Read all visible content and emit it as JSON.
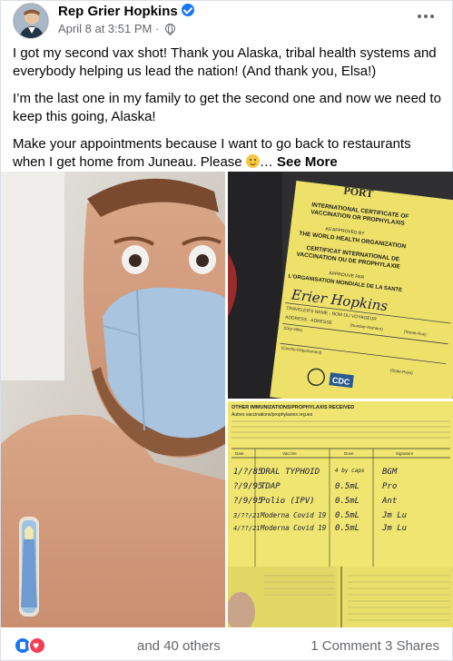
{
  "post": {
    "author": "Rep Grier Hopkins",
    "timestamp": "April 8 at 3:51 PM",
    "separator": "·",
    "privacy_icon": "globe-icon",
    "more_icon": "more-horizontal-icon",
    "paragraphs": [
      "I got my second vax shot! Thank you Alaska, tribal health systems and everybody helping us lead the nation! (And thank you, Elsa!)",
      "I’m the last one in my family to get the second one and now we need to keep this going, Alaska!"
    ],
    "truncated_paragraph": "Make your appointments because I want to go back to restaurants when I get home from Juneau. Please",
    "ellipsis": "…",
    "see_more": "See More"
  },
  "certificate": {
    "header_partial": "PORT",
    "title_en": "INTERNATIONAL CERTIFICATE OF VACCINATION OR PROPHYLAXIS",
    "approved_en": "AS APPROVED BY",
    "org_en": "THE WORLD HEALTH ORGANIZATION",
    "title_fr": "CERTIFICAT INTERNATIONAL DE VACCINATION OU DE PROPHYLAXIE",
    "approved_fr": "APPROUVE PAR",
    "org_fr": "L'ORGANISATION MONDIALE DE LA SANTE",
    "name_handwritten": "Erier Hopkins",
    "name_field": "TRAVELER'S NAME - NOM DU VOYAGEUR",
    "address_field": "ADDRESS - ADRESSE",
    "address_sub": [
      "(Number-Numéro)",
      "(Street-Rue)"
    ],
    "city_field": "(City-Ville)",
    "county_field": "(County-Département)",
    "state_field": "(State-Pays)",
    "logo_text": "CDC"
  },
  "record": {
    "heading": "OTHER IMMUNIZATIONS/PROPHYLAXIS RECEIVED",
    "heading_fr": "Autres vaccinations/prophylaxies reçues",
    "columns": [
      "Date",
      "Vaccine",
      "Dose",
      "Signature"
    ],
    "entries": [
      {
        "date": "1/?/85",
        "vaccine": "ORAL TYPHOID",
        "dose": "4 by caps",
        "sig": "BGM"
      },
      {
        "date": "?/9/95",
        "vaccine": "TDAP",
        "dose": "0.5mL",
        "sig": "Pro"
      },
      {
        "date": "?/9/95",
        "vaccine": "Polio (IPV)",
        "dose": "0.5mL",
        "sig": "Ant"
      },
      {
        "date": "3/??/21",
        "vaccine": "Moderna Covid 19",
        "dose": "0.5mL",
        "sig": "Jm Lu"
      },
      {
        "date": "4/??/21",
        "vaccine": "Moderna Covid 19",
        "dose": "0.5mL",
        "sig": "Jm Lu"
      }
    ]
  },
  "bandage": {
    "kind": "Elsa bandage"
  },
  "footer": {
    "reaction_icons": [
      "like-icon",
      "love-icon"
    ],
    "reactions_text": "and 40 others",
    "comments": "1 Comment",
    "shares": "3 Shares"
  },
  "colors": {
    "accent": "#1877f2",
    "love": "#f33e58",
    "secondary_text": "#65676b",
    "card_yellow": "#f2e56a"
  }
}
